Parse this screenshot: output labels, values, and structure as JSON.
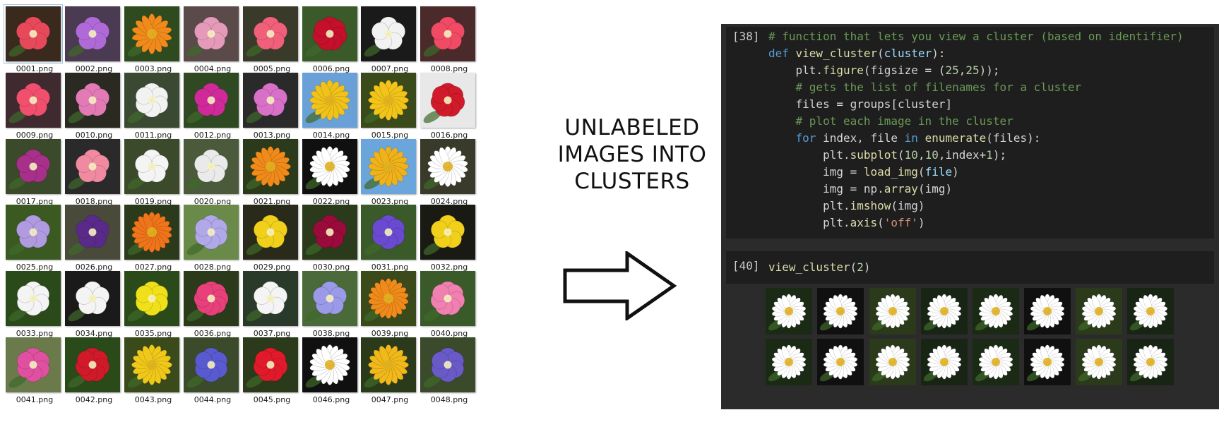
{
  "explorer": {
    "files": [
      {
        "name": "0001.png",
        "kind": "flower",
        "color": "#e8495a",
        "bg": "#3a2a1e",
        "petals": 5
      },
      {
        "name": "0002.png",
        "kind": "flower",
        "color": "#b06ad8",
        "bg": "#4a3a52",
        "petals": 5
      },
      {
        "name": "0003.png",
        "kind": "flower",
        "color": "#f08a1a",
        "bg": "#2f4a1f",
        "petals": 14
      },
      {
        "name": "0004.png",
        "kind": "flower",
        "color": "#e49ab8",
        "bg": "#5a4a4a",
        "petals": 5
      },
      {
        "name": "0005.png",
        "kind": "flower",
        "color": "#f0607a",
        "bg": "#3a3a2a",
        "petals": 5
      },
      {
        "name": "0006.png",
        "kind": "flower",
        "color": "#c4102a",
        "bg": "#3a5a2a",
        "petals": 7
      },
      {
        "name": "0007.png",
        "kind": "flower",
        "color": "#f2f2f2",
        "bg": "#1a1a1a",
        "petals": 5
      },
      {
        "name": "0008.png",
        "kind": "flower",
        "color": "#f04a64",
        "bg": "#4a2a2a",
        "petals": 5
      },
      {
        "name": "0009.png",
        "kind": "flower",
        "color": "#f0506e",
        "bg": "#3f2a30",
        "petals": 5
      },
      {
        "name": "0010.png",
        "kind": "flower",
        "color": "#e27ab6",
        "bg": "#2a2a22",
        "petals": 5
      },
      {
        "name": "0011.png",
        "kind": "flower",
        "color": "#f2f2f2",
        "bg": "#3a4a32",
        "petals": 6
      },
      {
        "name": "0012.png",
        "kind": "flower",
        "color": "#d02a9a",
        "bg": "#2f4a22",
        "petals": 5
      },
      {
        "name": "0013.png",
        "kind": "flower",
        "color": "#d870c8",
        "bg": "#2a2a2a",
        "petals": 5
      },
      {
        "name": "0014.png",
        "kind": "flower",
        "color": "#f0c21a",
        "bg": "#6aa0d8",
        "petals": 16
      },
      {
        "name": "0015.png",
        "kind": "flower",
        "color": "#f2c41a",
        "bg": "#3a4a1a",
        "petals": 16
      },
      {
        "name": "0016.png",
        "kind": "flower",
        "color": "#d01a2a",
        "bg": "#e8e8e8",
        "petals": 7
      },
      {
        "name": "0017.png",
        "kind": "flower",
        "color": "#a8308a",
        "bg": "#3a4a2a",
        "petals": 5
      },
      {
        "name": "0018.png",
        "kind": "flower",
        "color": "#f08aa0",
        "bg": "#2a2a2a",
        "petals": 5
      },
      {
        "name": "0019.png",
        "kind": "flower",
        "color": "#f4f4f4",
        "bg": "#3a4a2a",
        "petals": 5
      },
      {
        "name": "0020.png",
        "kind": "flower",
        "color": "#eaeaea",
        "bg": "#4a5a3a",
        "petals": 5
      },
      {
        "name": "0021.png",
        "kind": "flower",
        "color": "#f08a1a",
        "bg": "#2a3a1a",
        "petals": 16
      },
      {
        "name": "0022.png",
        "kind": "flower",
        "color": "#ffffff",
        "bg": "#101010",
        "petals": 18
      },
      {
        "name": "0023.png",
        "kind": "flower",
        "color": "#f0b21a",
        "bg": "#6aa6dc",
        "petals": 16
      },
      {
        "name": "0024.png",
        "kind": "flower",
        "color": "#ffffff",
        "bg": "#3a3a2a",
        "petals": 18
      },
      {
        "name": "0025.png",
        "kind": "flower",
        "color": "#b09ae0",
        "bg": "#3a5a22",
        "petals": 5
      },
      {
        "name": "0026.png",
        "kind": "flower",
        "color": "#5a2a8a",
        "bg": "#4a4a3a",
        "petals": 5
      },
      {
        "name": "0027.png",
        "kind": "flower",
        "color": "#f0741a",
        "bg": "#2a3a1a",
        "petals": 18
      },
      {
        "name": "0028.png",
        "kind": "flower",
        "color": "#b0a8e8",
        "bg": "#6a8a4a",
        "petals": 6
      },
      {
        "name": "0029.png",
        "kind": "flower",
        "color": "#f0d01a",
        "bg": "#2a2a1a",
        "petals": 5
      },
      {
        "name": "0030.png",
        "kind": "flower",
        "color": "#9a0a3a",
        "bg": "#2a3a1a",
        "petals": 5
      },
      {
        "name": "0031.png",
        "kind": "flower",
        "color": "#6a4ad0",
        "bg": "#3a5a2a",
        "petals": 6
      },
      {
        "name": "0032.png",
        "kind": "flower",
        "color": "#f0d01a",
        "bg": "#1a1a14",
        "petals": 5
      },
      {
        "name": "0033.png",
        "kind": "flower",
        "color": "#f4f4f4",
        "bg": "#2a4a1a",
        "petals": 6
      },
      {
        "name": "0034.png",
        "kind": "flower",
        "color": "#f4f4f4",
        "bg": "#1a1a1a",
        "petals": 5
      },
      {
        "name": "0035.png",
        "kind": "flower",
        "color": "#f0e01a",
        "bg": "#2a4a1a",
        "petals": 6
      },
      {
        "name": "0036.png",
        "kind": "flower",
        "color": "#e8407a",
        "bg": "#2a3a1a",
        "petals": 8
      },
      {
        "name": "0037.png",
        "kind": "flower",
        "color": "#f4f4f4",
        "bg": "#2a3a2a",
        "petals": 5
      },
      {
        "name": "0038.png",
        "kind": "flower",
        "color": "#9a9ae8",
        "bg": "#4a6a3a",
        "petals": 5
      },
      {
        "name": "0039.png",
        "kind": "flower",
        "color": "#f08a1a",
        "bg": "#3a4a1a",
        "petals": 18
      },
      {
        "name": "0040.png",
        "kind": "flower",
        "color": "#f080b0",
        "bg": "#3a5a2a",
        "petals": 7
      },
      {
        "name": "0041.png",
        "kind": "flower",
        "color": "#e050a0",
        "bg": "#6a7a4a",
        "petals": 6
      },
      {
        "name": "0042.png",
        "kind": "flower",
        "color": "#d01a2a",
        "bg": "#2a4a1a",
        "petals": 7
      },
      {
        "name": "0043.png",
        "kind": "flower",
        "color": "#f0c81a",
        "bg": "#3a4a1a",
        "petals": 16
      },
      {
        "name": "0044.png",
        "kind": "flower",
        "color": "#5a5ad0",
        "bg": "#3a4a2a",
        "petals": 6
      },
      {
        "name": "0045.png",
        "kind": "flower",
        "color": "#e01a2a",
        "bg": "#2a3a1a",
        "petals": 7
      },
      {
        "name": "0046.png",
        "kind": "flower",
        "color": "#ffffff",
        "bg": "#101010",
        "petals": 18
      },
      {
        "name": "0047.png",
        "kind": "flower",
        "color": "#f0b81a",
        "bg": "#2a3a1a",
        "petals": 16
      },
      {
        "name": "0048.png",
        "kind": "flower",
        "color": "#6a5ac8",
        "bg": "#3a4a2a",
        "petals": 6
      }
    ]
  },
  "middle": {
    "title_lines": [
      "UNLABELED",
      "IMAGES INTO",
      "CLUSTERS"
    ],
    "arrow_icon": "right-arrow-icon"
  },
  "notebook": {
    "cell1": {
      "prompt": "[38]",
      "lines": [
        [
          {
            "t": "# function that lets you view a cluster (based on identifier)",
            "c": "cm"
          }
        ],
        [
          {
            "t": "def ",
            "c": "kw"
          },
          {
            "t": "view_cluster",
            "c": "fn"
          },
          {
            "t": "(",
            "c": ""
          },
          {
            "t": "cluster",
            "c": "var"
          },
          {
            "t": "):",
            "c": ""
          }
        ],
        [
          {
            "t": "    plt.",
            "c": ""
          },
          {
            "t": "figure",
            "c": "fn"
          },
          {
            "t": "(figsize = (",
            "c": ""
          },
          {
            "t": "25",
            "c": "num"
          },
          {
            "t": ",",
            "c": ""
          },
          {
            "t": "25",
            "c": "num"
          },
          {
            "t": "));",
            "c": ""
          }
        ],
        [
          {
            "t": "    # gets the list of filenames for a cluster",
            "c": "cm"
          }
        ],
        [
          {
            "t": "    files = groups[cluster]",
            "c": ""
          }
        ],
        [
          {
            "t": "    # plot each image in the cluster",
            "c": "cm"
          }
        ],
        [
          {
            "t": "    ",
            "c": ""
          },
          {
            "t": "for",
            "c": "kw"
          },
          {
            "t": " index, file ",
            "c": ""
          },
          {
            "t": "in",
            "c": "kw"
          },
          {
            "t": " ",
            "c": ""
          },
          {
            "t": "enumerate",
            "c": "fn"
          },
          {
            "t": "(files):",
            "c": ""
          }
        ],
        [
          {
            "t": "        plt.",
            "c": ""
          },
          {
            "t": "subplot",
            "c": "fn"
          },
          {
            "t": "(",
            "c": ""
          },
          {
            "t": "10",
            "c": "num"
          },
          {
            "t": ",",
            "c": ""
          },
          {
            "t": "10",
            "c": "num"
          },
          {
            "t": ",index+",
            "c": ""
          },
          {
            "t": "1",
            "c": "num"
          },
          {
            "t": ");",
            "c": ""
          }
        ],
        [
          {
            "t": "        img = ",
            "c": ""
          },
          {
            "t": "load_img",
            "c": "fn"
          },
          {
            "t": "(",
            "c": ""
          },
          {
            "t": "file",
            "c": "var"
          },
          {
            "t": ")",
            "c": ""
          }
        ],
        [
          {
            "t": "        img = np.",
            "c": ""
          },
          {
            "t": "array",
            "c": "fn"
          },
          {
            "t": "(img)",
            "c": ""
          }
        ],
        [
          {
            "t": "        plt.",
            "c": ""
          },
          {
            "t": "imshow",
            "c": "fn"
          },
          {
            "t": "(img)",
            "c": ""
          }
        ],
        [
          {
            "t": "        plt.",
            "c": ""
          },
          {
            "t": "axis",
            "c": "fn"
          },
          {
            "t": "(",
            "c": ""
          },
          {
            "t": "'off'",
            "c": "str"
          },
          {
            "t": ")",
            "c": ""
          }
        ]
      ]
    },
    "cell2": {
      "prompt": "[40]",
      "lines": [
        [
          {
            "t": "view_cluster",
            "c": "fn"
          },
          {
            "t": "(",
            "c": ""
          },
          {
            "t": "2",
            "c": "num"
          },
          {
            "t": ")",
            "c": ""
          }
        ]
      ]
    },
    "output": {
      "image_kind": "daisy",
      "rows": 2,
      "cols": 8
    }
  },
  "colors": {
    "notebook_bg": "#2b2b2b",
    "cell_bg": "#1e1e1e",
    "comment": "#6a9955",
    "keyword": "#569cd6",
    "function": "#dcdcaa",
    "number": "#b5cea8",
    "string": "#ce9178"
  }
}
